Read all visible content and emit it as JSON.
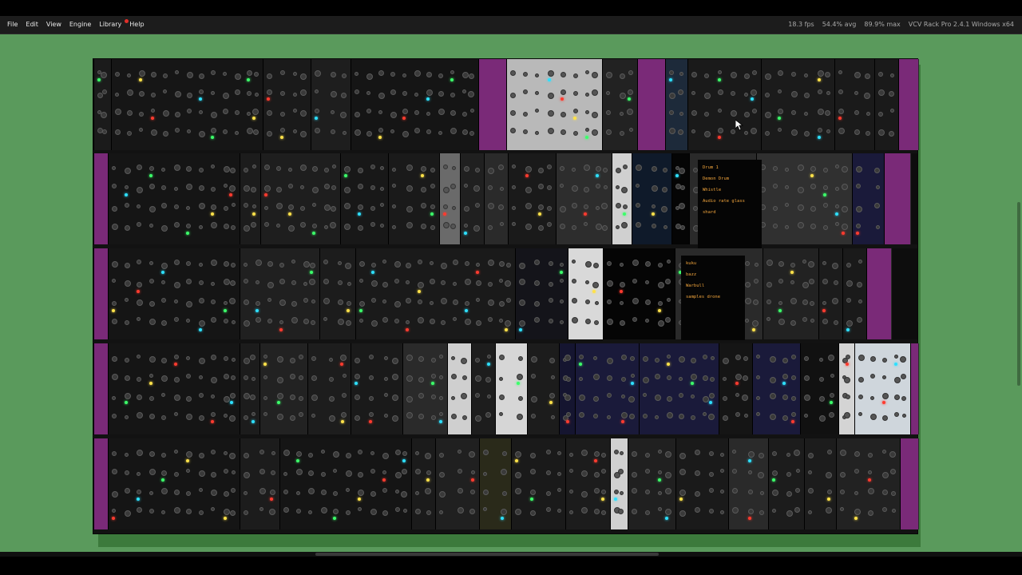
{
  "menu": {
    "items": [
      "File",
      "Edit",
      "View",
      "Engine",
      "Library",
      "Help"
    ]
  },
  "status": {
    "fps": "18.3 fps",
    "avg": "54.4% avg",
    "max": "89.9% max",
    "app": "VCV Rack Pro 2.4.1 Windows x64"
  },
  "displays": {
    "display1_lines": [
      "Drum 1",
      "Demon Drum",
      "Whistle",
      "Audio rate glass\nshard"
    ],
    "display2_lines": [
      "kuku",
      "bazz",
      "Warbull",
      "samples drone"
    ]
  },
  "colors": {
    "workspace": "#5a9a5c",
    "rack": "#121212",
    "panel_dark": "#1a1a1a",
    "accent_green": "#3cff6a",
    "accent_purple": "#8a2a86",
    "display_amber": "#f2a53c"
  }
}
